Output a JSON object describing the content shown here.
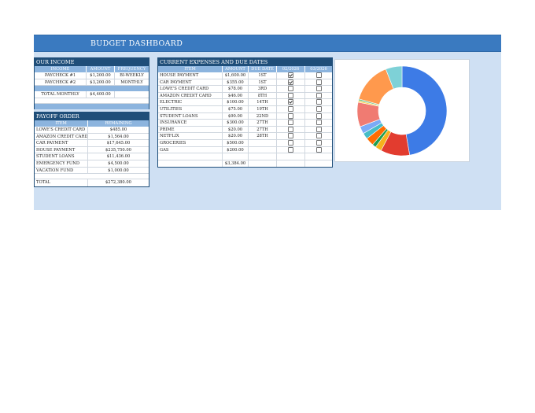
{
  "dashboard": {
    "title": "BUDGET DASHBOARD"
  },
  "income": {
    "header": "OUR INCOME",
    "columns": [
      "INCOME",
      "AMOUNT",
      "FREQUENCY"
    ],
    "rows": [
      [
        "PAYCHECK #1",
        "$1,200.00",
        "BI-WEEKLY"
      ],
      [
        "PAYCHECK #2",
        "$3,200.00",
        "MONTHLY"
      ]
    ],
    "total_label": "TOTAL MONTHLY",
    "total_value": "$4,400.00"
  },
  "payoff": {
    "header": "PAYOFF ORDER",
    "columns": [
      "ITEM",
      "REMAINING"
    ],
    "rows": [
      [
        "LOWE'S CREDIT CARD",
        "$485.00"
      ],
      [
        "AMAZON CREDIT CARD",
        "$1,564.00"
      ],
      [
        "CAR PAYMENT",
        "$17,645.00"
      ],
      [
        "HOUSE PAYMENT",
        "$235,750.00"
      ],
      [
        "STUDENT LOANS",
        "$11,436.00"
      ],
      [
        "EMERGENCY FUND",
        "$4,500.00"
      ],
      [
        "VACATION FUND",
        "$1,000.00"
      ]
    ],
    "total_label": "TOTAL",
    "total_value": "$272,380.00"
  },
  "expenses": {
    "header": "CURRENT EXPENSES AND DUE DATES",
    "columns": [
      "ITEM",
      "AMOUNT",
      "DUE DATE",
      "02/2026",
      "03/2026"
    ],
    "rows": [
      {
        "item": "HOUSE PAYMENT",
        "amount": "$1,600.00",
        "due": "1ST",
        "m1": true,
        "m2": false
      },
      {
        "item": "CAR PAYMENT",
        "amount": "$355.00",
        "due": "1ST",
        "m1": true,
        "m2": false
      },
      {
        "item": "LOWE'S CREDIT CARD",
        "amount": "$78.00",
        "due": "3RD",
        "m1": false,
        "m2": false
      },
      {
        "item": "AMAZON CREDIT CARD",
        "amount": "$46.00",
        "due": "8TH",
        "m1": false,
        "m2": false
      },
      {
        "item": "ELECTRIC",
        "amount": "$100.00",
        "due": "14TH",
        "m1": true,
        "m2": false
      },
      {
        "item": "UTILITIES",
        "amount": "$75.00",
        "due": "19TH",
        "m1": false,
        "m2": false
      },
      {
        "item": "STUDENT LOANS",
        "amount": "$90.00",
        "due": "22ND",
        "m1": false,
        "m2": false
      },
      {
        "item": "INSURANCE",
        "amount": "$300.00",
        "due": "27TH",
        "m1": false,
        "m2": false
      },
      {
        "item": "PRIME",
        "amount": "$20.00",
        "due": "27TH",
        "m1": false,
        "m2": false
      },
      {
        "item": "NETFLIX",
        "amount": "$20.00",
        "due": "28TH",
        "m1": false,
        "m2": false
      },
      {
        "item": "GROCERIES",
        "amount": "$500.00",
        "due": "",
        "m1": false,
        "m2": false
      },
      {
        "item": "GAS",
        "amount": "$200.00",
        "due": "",
        "m1": false,
        "m2": false
      }
    ],
    "total_value": "$3,384.00"
  },
  "chart_data": {
    "type": "pie",
    "subtype": "donut",
    "legend": "labels-with-leader-lines",
    "categories": [
      "HOUSE PAYMENT",
      "CAR PAYMENT",
      "LOWE'S CREDIT CARD",
      "AMAZON CREDIT CARD",
      "ELECTRIC",
      "UTILITIES",
      "STUDENT LOANS",
      "INSURANCE",
      "PRIME",
      "NETFLIX",
      "GROCERIES",
      "GAS"
    ],
    "values": [
      1600,
      355,
      78,
      46,
      100,
      75,
      90,
      300,
      20,
      20,
      500,
      200
    ],
    "colors": [
      "#3d7be6",
      "#e23c2f",
      "#f6b21c",
      "#1e9e4f",
      "#ff6d01",
      "#46bdc6",
      "#7baaf7",
      "#f07b72",
      "#fcd04f",
      "#71c287",
      "#ff994d",
      "#7ed1d7"
    ]
  }
}
